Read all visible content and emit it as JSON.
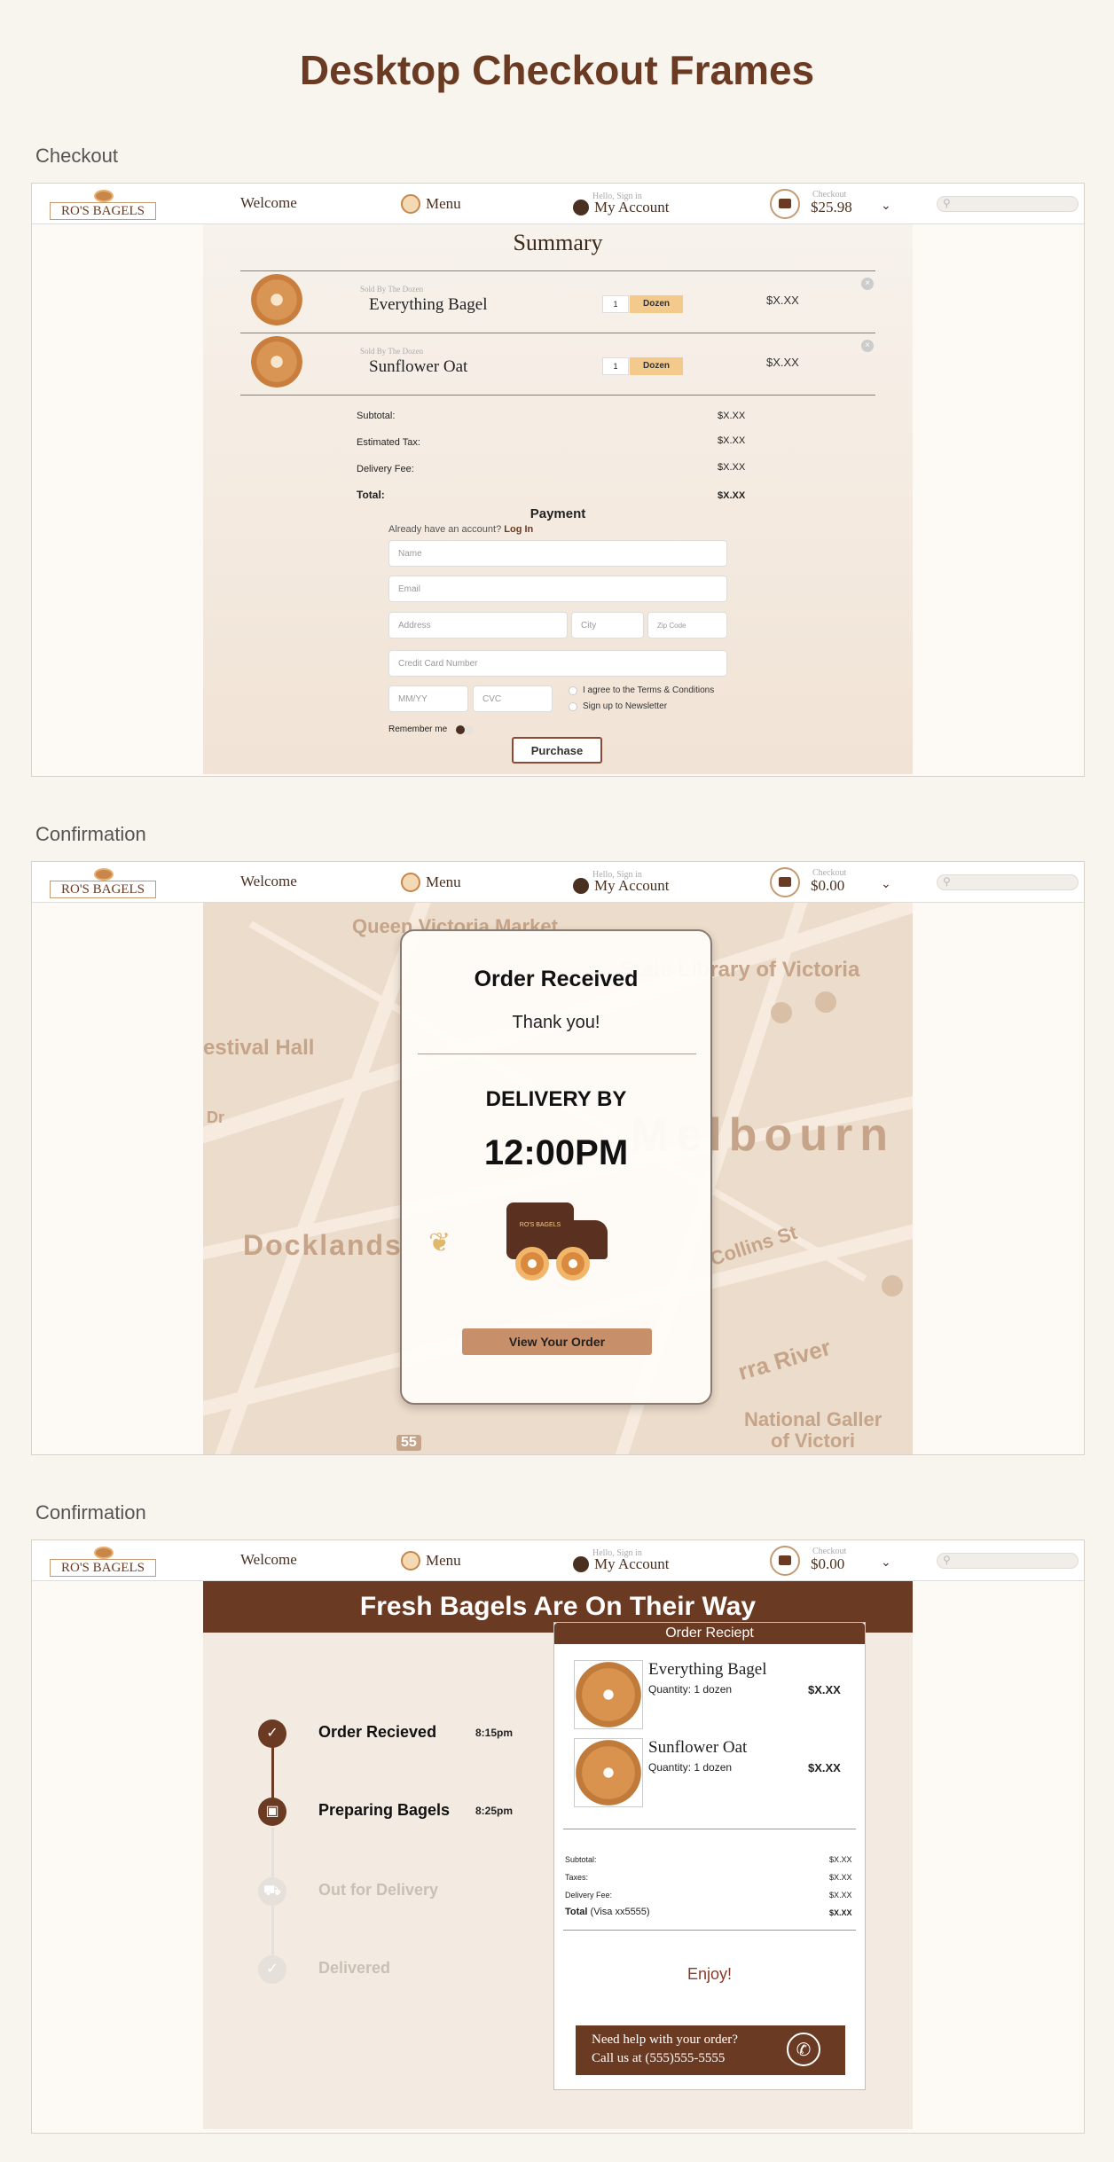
{
  "page_title": "Desktop Checkout Frames",
  "sections": [
    "Checkout",
    "Confirmation",
    "Confirmation"
  ],
  "nav": {
    "logo": "RO'S BAGELS",
    "welcome": "Welcome",
    "menu": "Menu",
    "hello": "Hello, Sign in",
    "account": "My Account",
    "checkout_label": "Checkout",
    "cart_total_checkout": "$25.98",
    "cart_total_confirm": "$0.00",
    "chevron": "⌄",
    "search_icon": "⚲"
  },
  "checkout": {
    "title": "Summary",
    "items": [
      {
        "sold_by": "Sold By The Dozen",
        "name": "Everything Bagel",
        "qty": "1",
        "unit": "Dozen",
        "price": "$X.XX"
      },
      {
        "sold_by": "Sold By The Dozen",
        "name": "Sunflower Oat",
        "qty": "1",
        "unit": "Dozen",
        "price": "$X.XX"
      }
    ],
    "totals": [
      {
        "label": "Subtotal:",
        "value": "$X.XX"
      },
      {
        "label": "Estimated Tax:",
        "value": "$X.XX"
      },
      {
        "label": "Delivery Fee:",
        "value": "$X.XX"
      },
      {
        "label": "Total:",
        "value": "$X.XX"
      }
    ],
    "payment": {
      "title": "Payment",
      "login_prompt": "Already have an account?",
      "login_link": "Log In",
      "name": "Name",
      "email": "Email",
      "address": "Address",
      "city": "City",
      "zip": "Zip Code",
      "card": "Credit Card Number",
      "exp": "MM/YY",
      "cvc": "CVC",
      "terms": "I agree to the Terms & Conditions",
      "newsletter": "Sign up to Newsletter",
      "remember": "Remember me",
      "purchase": "Purchase"
    }
  },
  "confirm1": {
    "title": "Order Received",
    "thanks": "Thank you!",
    "delivery_by": "DELIVERY BY",
    "time": "12:00PM",
    "truck_logo": "RO'S BAGELS",
    "view_order": "View Your Order",
    "map_labels": [
      "Queen Victoria Market",
      "State Library of Victoria",
      "estival Hall",
      "Melbourn",
      "Docklands",
      "Collins St",
      "rra River",
      "National Galler",
      "of Victori",
      "55",
      "Dr"
    ]
  },
  "confirm2": {
    "banner": "Fresh Bagels Are On Their Way",
    "steps": [
      {
        "label": "Order Recieved",
        "time": "8:15pm",
        "icon": "✓"
      },
      {
        "label": "Preparing Bagels",
        "time": "8:25pm",
        "icon": "▣"
      },
      {
        "label": "Out for Delivery",
        "time": "",
        "icon": "⛟"
      },
      {
        "label": "Delivered",
        "time": "",
        "icon": "✓"
      }
    ],
    "receipt": {
      "title": "Order Reciept",
      "items": [
        {
          "name": "Everything Bagel",
          "qty": "Quantity: 1 dozen",
          "price": "$X.XX"
        },
        {
          "name": "Sunflower Oat",
          "qty": "Quantity: 1 dozen",
          "price": "$X.XX"
        }
      ],
      "totals": [
        {
          "label": "Subtotal:",
          "value": "$X.XX"
        },
        {
          "label": "Taxes:",
          "value": "$X.XX"
        },
        {
          "label": "Delivery Fee:",
          "value": "$X.XX"
        }
      ],
      "total_label": "Total",
      "total_card": "(Visa xx5555)",
      "total_value": "$X.XX",
      "enjoy": "Enjoy!",
      "help_line1": "Need help with your order?",
      "help_line2": "Call us at (555)555-5555",
      "phone_icon": "✆"
    }
  }
}
